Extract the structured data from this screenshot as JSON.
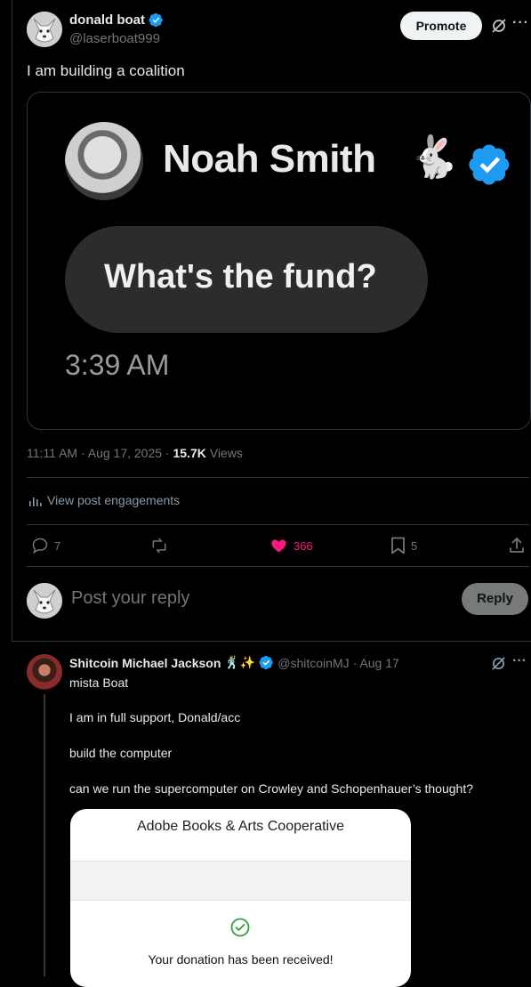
{
  "main_post": {
    "author_name": "donald boat",
    "author_handle": "@laserboat999",
    "promote_label": "Promote",
    "text": "I am building a coalition",
    "embedded_image": {
      "profile_name": "Noah Smith",
      "message": "What's the fund?",
      "time": "3:39 AM"
    },
    "timestamp": "11:11 AM · Aug 17, 2025 · ",
    "views_count": "15.7K",
    "views_label": " Views",
    "engagements_label": "View post engagements",
    "actions": {
      "replies": "7",
      "likes": "366",
      "bookmarks": "5"
    }
  },
  "reply_box": {
    "placeholder": "Post your reply",
    "reply_button": "Reply"
  },
  "reply_post": {
    "author_name": "Shitcoin Michael Jackson",
    "author_emoji": "🕺✨",
    "author_handle": "@shitcoinMJ",
    "date": "· Aug 17",
    "lines": [
      "mista Boat",
      "I am in full support, Donald/acc",
      "build the computer",
      "can we run the supercomputer on Crowley and Schopenhauer’s thought?"
    ],
    "card": {
      "title": "Adobe Books & Arts Cooperative",
      "message": "Your donation has been received!"
    }
  },
  "colors": {
    "verified_blue": "#1d9bf0",
    "like_pink": "#f91880",
    "divider": "#2f3336"
  }
}
